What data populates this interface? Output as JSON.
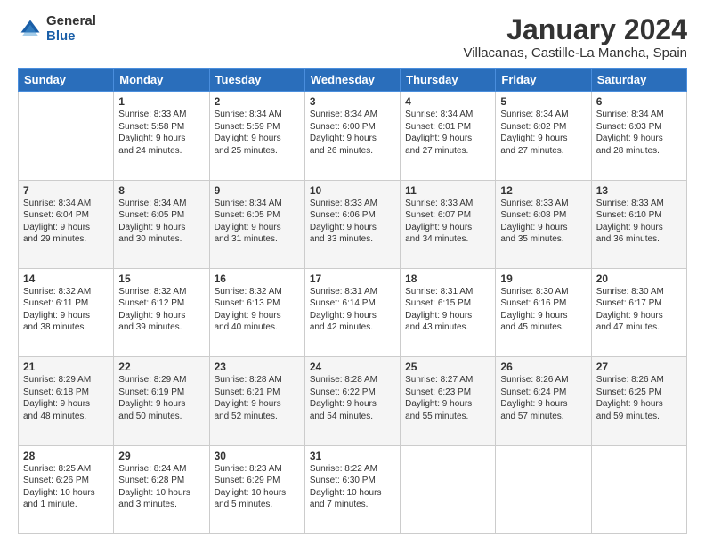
{
  "logo": {
    "general": "General",
    "blue": "Blue"
  },
  "title": "January 2024",
  "subtitle": "Villacanas, Castille-La Mancha, Spain",
  "days": [
    "Sunday",
    "Monday",
    "Tuesday",
    "Wednesday",
    "Thursday",
    "Friday",
    "Saturday"
  ],
  "weeks": [
    [
      {
        "num": "",
        "info": ""
      },
      {
        "num": "1",
        "info": "Sunrise: 8:33 AM\nSunset: 5:58 PM\nDaylight: 9 hours\nand 24 minutes."
      },
      {
        "num": "2",
        "info": "Sunrise: 8:34 AM\nSunset: 5:59 PM\nDaylight: 9 hours\nand 25 minutes."
      },
      {
        "num": "3",
        "info": "Sunrise: 8:34 AM\nSunset: 6:00 PM\nDaylight: 9 hours\nand 26 minutes."
      },
      {
        "num": "4",
        "info": "Sunrise: 8:34 AM\nSunset: 6:01 PM\nDaylight: 9 hours\nand 27 minutes."
      },
      {
        "num": "5",
        "info": "Sunrise: 8:34 AM\nSunset: 6:02 PM\nDaylight: 9 hours\nand 27 minutes."
      },
      {
        "num": "6",
        "info": "Sunrise: 8:34 AM\nSunset: 6:03 PM\nDaylight: 9 hours\nand 28 minutes."
      }
    ],
    [
      {
        "num": "7",
        "info": "Sunrise: 8:34 AM\nSunset: 6:04 PM\nDaylight: 9 hours\nand 29 minutes."
      },
      {
        "num": "8",
        "info": "Sunrise: 8:34 AM\nSunset: 6:05 PM\nDaylight: 9 hours\nand 30 minutes."
      },
      {
        "num": "9",
        "info": "Sunrise: 8:34 AM\nSunset: 6:05 PM\nDaylight: 9 hours\nand 31 minutes."
      },
      {
        "num": "10",
        "info": "Sunrise: 8:33 AM\nSunset: 6:06 PM\nDaylight: 9 hours\nand 33 minutes."
      },
      {
        "num": "11",
        "info": "Sunrise: 8:33 AM\nSunset: 6:07 PM\nDaylight: 9 hours\nand 34 minutes."
      },
      {
        "num": "12",
        "info": "Sunrise: 8:33 AM\nSunset: 6:08 PM\nDaylight: 9 hours\nand 35 minutes."
      },
      {
        "num": "13",
        "info": "Sunrise: 8:33 AM\nSunset: 6:10 PM\nDaylight: 9 hours\nand 36 minutes."
      }
    ],
    [
      {
        "num": "14",
        "info": "Sunrise: 8:32 AM\nSunset: 6:11 PM\nDaylight: 9 hours\nand 38 minutes."
      },
      {
        "num": "15",
        "info": "Sunrise: 8:32 AM\nSunset: 6:12 PM\nDaylight: 9 hours\nand 39 minutes."
      },
      {
        "num": "16",
        "info": "Sunrise: 8:32 AM\nSunset: 6:13 PM\nDaylight: 9 hours\nand 40 minutes."
      },
      {
        "num": "17",
        "info": "Sunrise: 8:31 AM\nSunset: 6:14 PM\nDaylight: 9 hours\nand 42 minutes."
      },
      {
        "num": "18",
        "info": "Sunrise: 8:31 AM\nSunset: 6:15 PM\nDaylight: 9 hours\nand 43 minutes."
      },
      {
        "num": "19",
        "info": "Sunrise: 8:30 AM\nSunset: 6:16 PM\nDaylight: 9 hours\nand 45 minutes."
      },
      {
        "num": "20",
        "info": "Sunrise: 8:30 AM\nSunset: 6:17 PM\nDaylight: 9 hours\nand 47 minutes."
      }
    ],
    [
      {
        "num": "21",
        "info": "Sunrise: 8:29 AM\nSunset: 6:18 PM\nDaylight: 9 hours\nand 48 minutes."
      },
      {
        "num": "22",
        "info": "Sunrise: 8:29 AM\nSunset: 6:19 PM\nDaylight: 9 hours\nand 50 minutes."
      },
      {
        "num": "23",
        "info": "Sunrise: 8:28 AM\nSunset: 6:21 PM\nDaylight: 9 hours\nand 52 minutes."
      },
      {
        "num": "24",
        "info": "Sunrise: 8:28 AM\nSunset: 6:22 PM\nDaylight: 9 hours\nand 54 minutes."
      },
      {
        "num": "25",
        "info": "Sunrise: 8:27 AM\nSunset: 6:23 PM\nDaylight: 9 hours\nand 55 minutes."
      },
      {
        "num": "26",
        "info": "Sunrise: 8:26 AM\nSunset: 6:24 PM\nDaylight: 9 hours\nand 57 minutes."
      },
      {
        "num": "27",
        "info": "Sunrise: 8:26 AM\nSunset: 6:25 PM\nDaylight: 9 hours\nand 59 minutes."
      }
    ],
    [
      {
        "num": "28",
        "info": "Sunrise: 8:25 AM\nSunset: 6:26 PM\nDaylight: 10 hours\nand 1 minute."
      },
      {
        "num": "29",
        "info": "Sunrise: 8:24 AM\nSunset: 6:28 PM\nDaylight: 10 hours\nand 3 minutes."
      },
      {
        "num": "30",
        "info": "Sunrise: 8:23 AM\nSunset: 6:29 PM\nDaylight: 10 hours\nand 5 minutes."
      },
      {
        "num": "31",
        "info": "Sunrise: 8:22 AM\nSunset: 6:30 PM\nDaylight: 10 hours\nand 7 minutes."
      },
      {
        "num": "",
        "info": ""
      },
      {
        "num": "",
        "info": ""
      },
      {
        "num": "",
        "info": ""
      }
    ]
  ]
}
